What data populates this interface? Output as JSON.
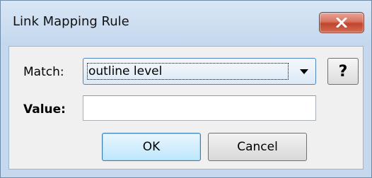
{
  "window": {
    "title": "Link Mapping Rule",
    "close_icon": "close-icon"
  },
  "form": {
    "match_label": "Match:",
    "match_value": "outline level",
    "help_label": "?",
    "value_label": "Value:",
    "value_text": ""
  },
  "buttons": {
    "ok": "OK",
    "cancel": "Cancel"
  },
  "colors": {
    "close_button": "#c2442c",
    "ok_border": "#3c7fb1",
    "frame": "#c5d8ee"
  }
}
